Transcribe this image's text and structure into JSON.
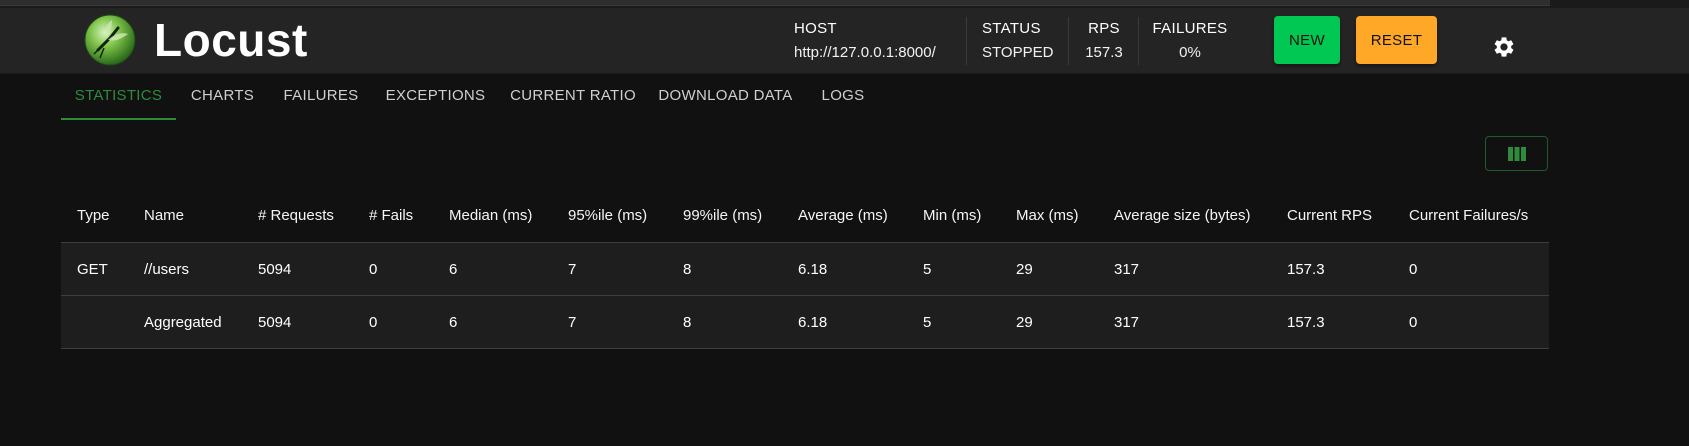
{
  "app": {
    "title": "Locust"
  },
  "header": {
    "host": {
      "label": "HOST",
      "value": "http://127.0.0.1:8000/"
    },
    "status": {
      "label": "STATUS",
      "value": "STOPPED"
    },
    "rps": {
      "label": "RPS",
      "value": "157.3"
    },
    "failures": {
      "label": "FAILURES",
      "value": "0%"
    },
    "new_label": "NEW",
    "reset_label": "RESET",
    "settings_icon": "gear-icon"
  },
  "tabs": [
    {
      "label": "STATISTICS",
      "active": true
    },
    {
      "label": "CHARTS"
    },
    {
      "label": "FAILURES"
    },
    {
      "label": "EXCEPTIONS"
    },
    {
      "label": "CURRENT RATIO"
    },
    {
      "label": "DOWNLOAD DATA"
    },
    {
      "label": "LOGS"
    }
  ],
  "table": {
    "columns": [
      "Type",
      "Name",
      "# Requests",
      "# Fails",
      "Median (ms)",
      "95%ile (ms)",
      "99%ile (ms)",
      "Average (ms)",
      "Min (ms)",
      "Max (ms)",
      "Average size (bytes)",
      "Current RPS",
      "Current Failures/s"
    ],
    "rows": [
      [
        "GET",
        "//users",
        "5094",
        "0",
        "6",
        "7",
        "8",
        "6.18",
        "5",
        "29",
        "317",
        "157.3",
        "0"
      ],
      [
        "",
        "Aggregated",
        "5094",
        "0",
        "6",
        "7",
        "8",
        "6.18",
        "5",
        "29",
        "317",
        "157.3",
        "0"
      ]
    ]
  },
  "colors": {
    "accent_green": "#00c853",
    "reset_orange": "#ffa726",
    "active_tab": "#2e8b3c"
  }
}
